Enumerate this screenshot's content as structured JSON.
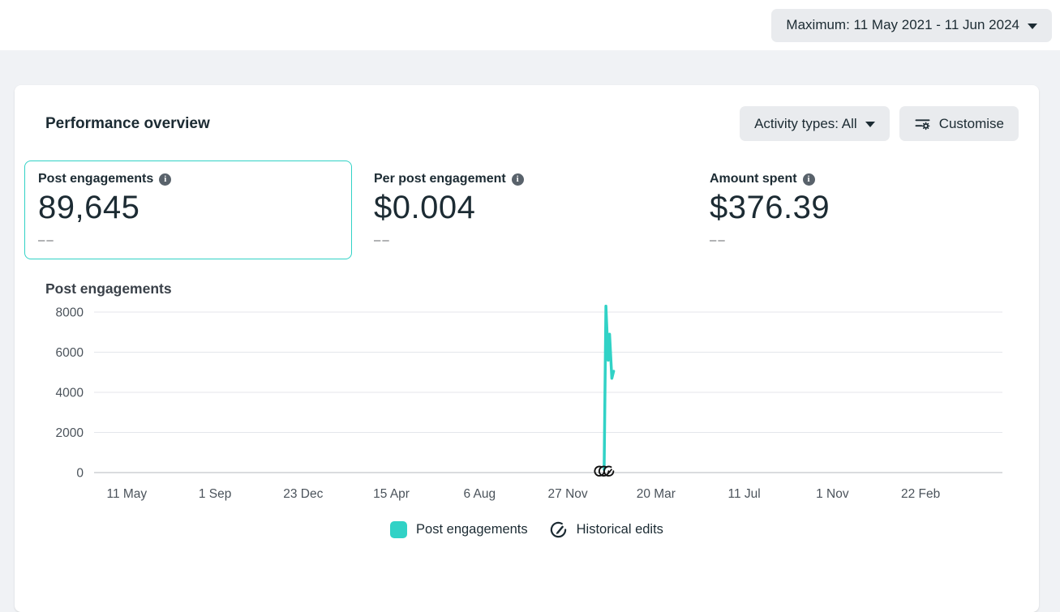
{
  "header": {
    "date_range_label": "Maximum: 11 May 2021 - 11 Jun 2024"
  },
  "panel": {
    "title": "Performance overview",
    "activity_filter_label": "Activity types: All",
    "customise_label": "Customise",
    "metrics": [
      {
        "label": "Post engagements",
        "value": "89,645",
        "delta": "––",
        "selected": true
      },
      {
        "label": "Per post engagement",
        "value": "$0.004",
        "delta": "––",
        "selected": false
      },
      {
        "label": "Amount spent",
        "value": "$376.39",
        "delta": "––",
        "selected": false
      }
    ],
    "chart_title": "Post engagements"
  },
  "legend": {
    "series_label": "Post engagements",
    "edits_label": "Historical edits"
  },
  "colors": {
    "accent_teal": "#31d2c6",
    "grid_line": "#e4e6eb",
    "axis_line": "#ced0d4",
    "marker_dark": "#111111"
  },
  "icons": {
    "date_caret": "caret-down-icon",
    "activity_caret": "caret-down-icon",
    "customise": "sliders-gear-icon",
    "info": "info-icon",
    "historical_edits": "pencil-circle-icon"
  },
  "chart_data": {
    "type": "line",
    "title": "Post engagements",
    "xlabel": "",
    "ylabel": "",
    "ylim": [
      0,
      8000
    ],
    "yticks": [
      0,
      2000,
      4000,
      6000,
      8000
    ],
    "x_tick_labels": [
      "11 May",
      "1 Sep",
      "23 Dec",
      "15 Apr",
      "6 Aug",
      "27 Nov",
      "20 Mar",
      "11 Jul",
      "1 Nov",
      "22 Feb"
    ],
    "x_axis_range_note": "11 May 2021 - 11 Jun 2024",
    "grid": "horizontal",
    "legend_position": "bottom-center",
    "x_tick_fraction_start": 0.036,
    "x_tick_fraction_step": 0.0971,
    "series": [
      {
        "name": "Post engagements",
        "color": "#31d2c6",
        "points": [
          [
            0.5615,
            150
          ],
          [
            0.5635,
            8300
          ],
          [
            0.566,
            5600
          ],
          [
            0.5675,
            6900
          ],
          [
            0.57,
            4700
          ],
          [
            0.572,
            5050
          ]
        ]
      }
    ],
    "historical_edits_marker_fraction": 0.566
  }
}
